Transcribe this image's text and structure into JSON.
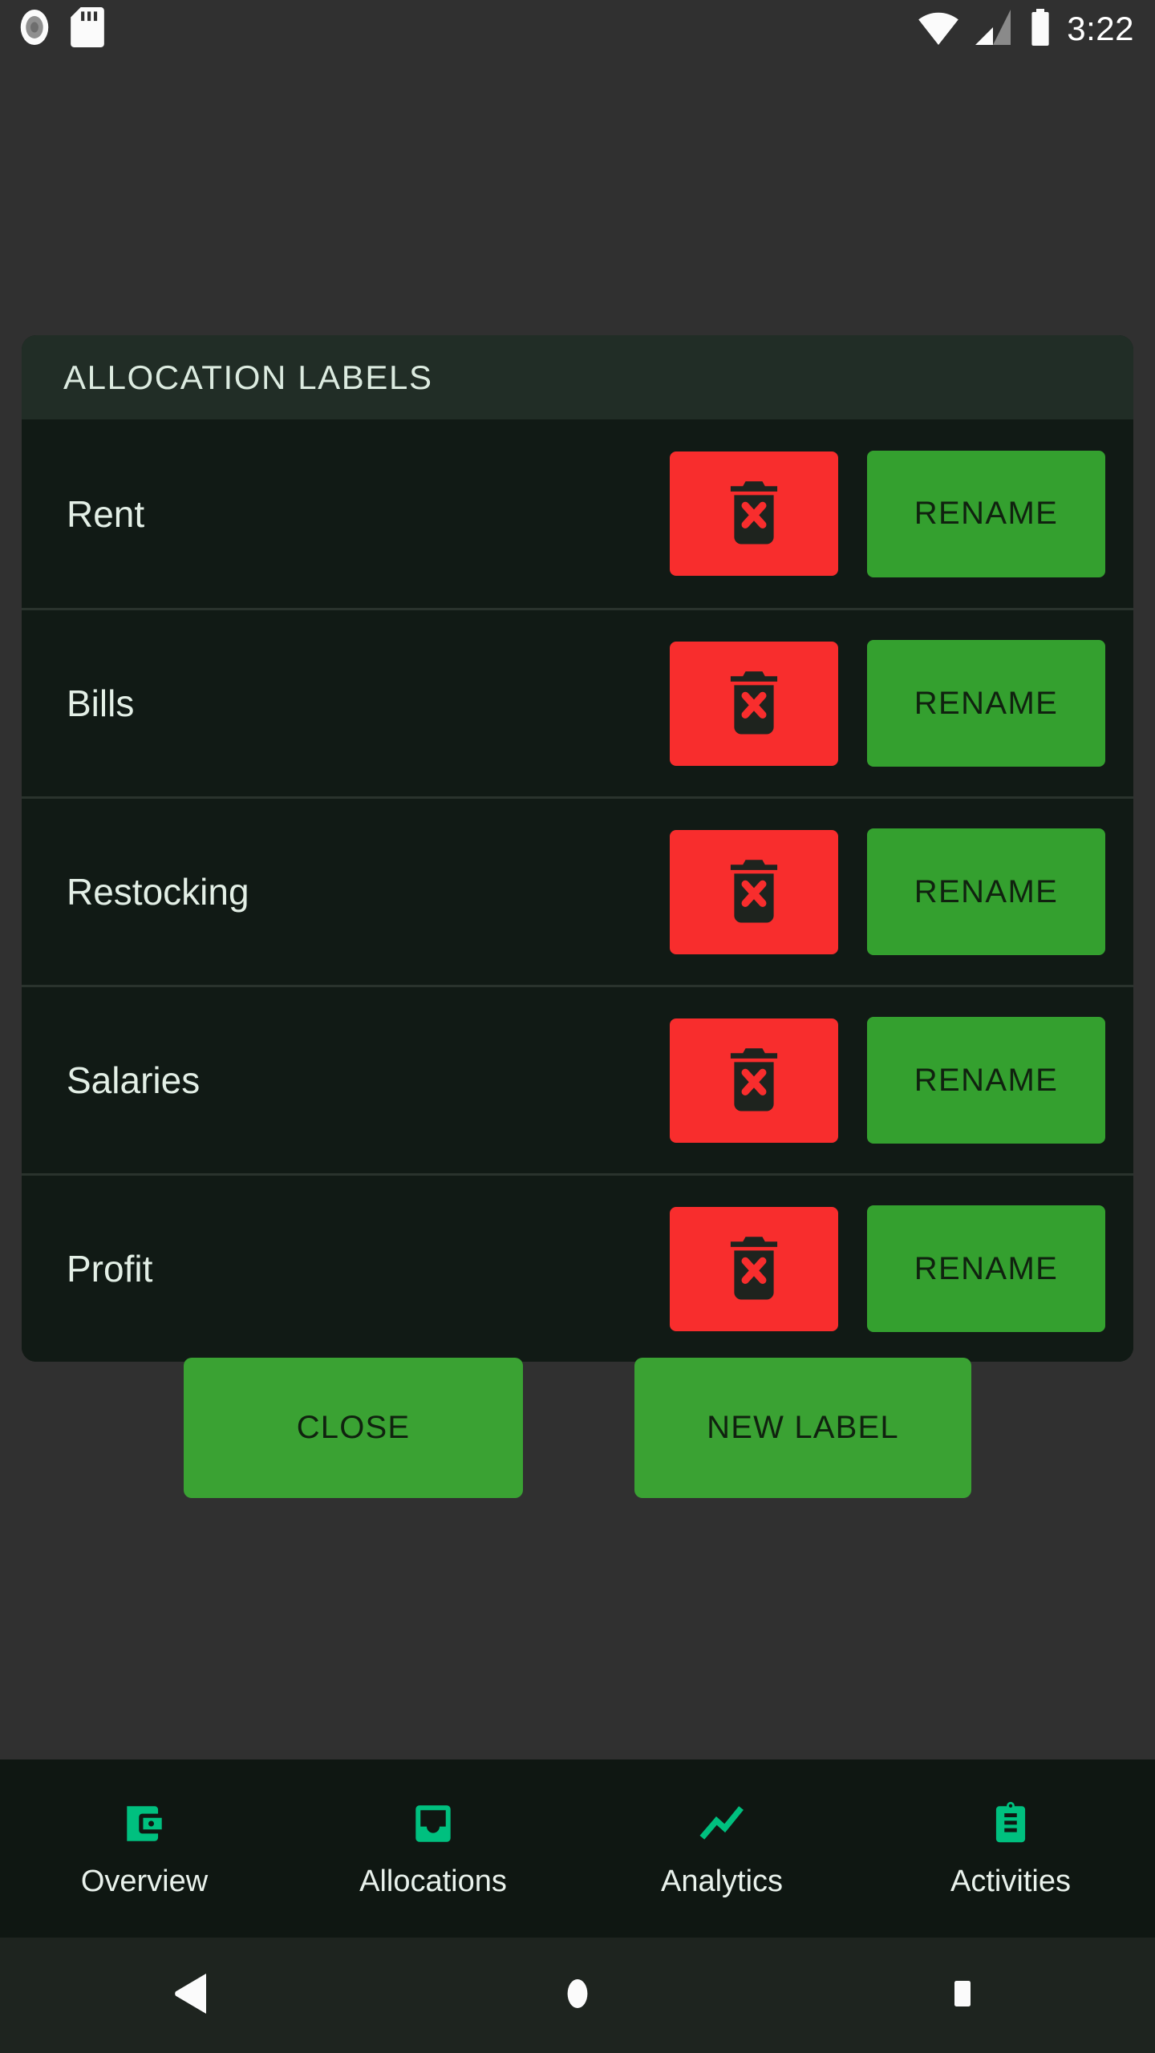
{
  "status_bar": {
    "time": "3:22",
    "icons": [
      "screen-record-icon",
      "sd-card-icon",
      "wifi-icon",
      "cellular-signal-icon",
      "battery-icon"
    ]
  },
  "dialog": {
    "title": "ALLOCATION LABELS",
    "rows": [
      {
        "label": "Rent",
        "delete_icon": "trash-x-icon",
        "rename_label": "RENAME"
      },
      {
        "label": "Bills",
        "delete_icon": "trash-x-icon",
        "rename_label": "RENAME"
      },
      {
        "label": "Restocking",
        "delete_icon": "trash-x-icon",
        "rename_label": "RENAME"
      },
      {
        "label": "Salaries",
        "delete_icon": "trash-x-icon",
        "rename_label": "RENAME"
      },
      {
        "label": "Profit",
        "delete_icon": "trash-x-icon",
        "rename_label": "RENAME"
      }
    ],
    "close_label": "CLOSE",
    "new_label": "NEW LABEL"
  },
  "bottom_nav": {
    "items": [
      {
        "label": "Overview",
        "icon": "wallet-icon"
      },
      {
        "label": "Allocations",
        "icon": "inbox-icon"
      },
      {
        "label": "Analytics",
        "icon": "trending-up-icon"
      },
      {
        "label": "Activities",
        "icon": "clipboard-icon"
      }
    ]
  },
  "android_nav": {
    "back": "back-triangle-icon",
    "home": "home-circle-icon",
    "recents": "recents-square-icon"
  },
  "colors": {
    "screen_background": "#303030",
    "card_background": "#111a15",
    "card_header": "#212d26",
    "delete_red": "#f82d2d",
    "action_green": "#34a02f",
    "nav_accent_green": "#00c07f",
    "nav_background": "#0f1712"
  }
}
